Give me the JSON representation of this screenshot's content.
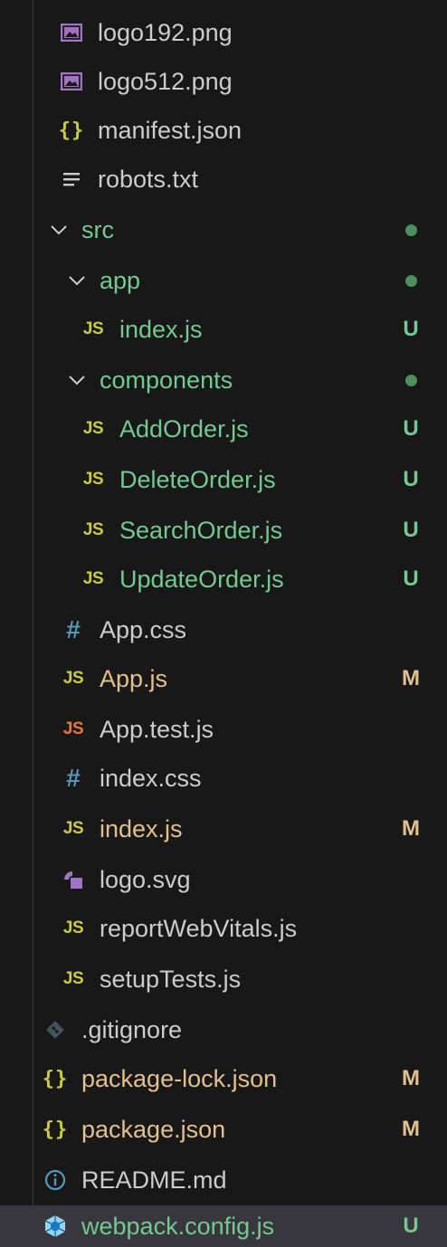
{
  "colors": {
    "background": "#181818",
    "selected_row": "#37373d",
    "untracked": "#73c991",
    "modified": "#e2c08d",
    "default_text": "#cccccc",
    "js_icon": "#cbcb41",
    "test_js_icon": "#e37933",
    "css_icon": "#519aba",
    "image_icon": "#a074c4",
    "git_dot": "#4e8f5e"
  },
  "rows": [
    {
      "label": "logo192.png",
      "icon": "image-icon",
      "icon_text": "",
      "state": "plain",
      "badge": ""
    },
    {
      "label": "logo512.png",
      "icon": "image-icon",
      "icon_text": "",
      "state": "plain",
      "badge": ""
    },
    {
      "label": "manifest.json",
      "icon": "json-braces-icon",
      "icon_text": "{}",
      "state": "plain",
      "badge": ""
    },
    {
      "label": "robots.txt",
      "icon": "text-lines-icon",
      "icon_text": "",
      "state": "plain",
      "badge": ""
    },
    {
      "label": "src",
      "icon": "chevron-down-icon",
      "icon_text": "",
      "state": "untracked",
      "badge": "dot"
    },
    {
      "label": "app",
      "icon": "chevron-down-icon",
      "icon_text": "",
      "state": "untracked",
      "badge": "dot"
    },
    {
      "label": "index.js",
      "icon": "js-icon",
      "icon_text": "JS",
      "state": "untracked",
      "badge": "U"
    },
    {
      "label": "components",
      "icon": "chevron-down-icon",
      "icon_text": "",
      "state": "untracked",
      "badge": "dot"
    },
    {
      "label": "AddOrder.js",
      "icon": "js-icon",
      "icon_text": "JS",
      "state": "untracked",
      "badge": "U"
    },
    {
      "label": "DeleteOrder.js",
      "icon": "js-icon",
      "icon_text": "JS",
      "state": "untracked",
      "badge": "U"
    },
    {
      "label": "SearchOrder.js",
      "icon": "js-icon",
      "icon_text": "JS",
      "state": "untracked",
      "badge": "U"
    },
    {
      "label": "UpdateOrder.js",
      "icon": "js-icon",
      "icon_text": "JS",
      "state": "untracked",
      "badge": "U"
    },
    {
      "label": "App.css",
      "icon": "css-hash-icon",
      "icon_text": "#",
      "state": "plain",
      "badge": ""
    },
    {
      "label": "App.js",
      "icon": "js-icon",
      "icon_text": "JS",
      "state": "modified",
      "badge": "M"
    },
    {
      "label": "App.test.js",
      "icon": "test-js-icon",
      "icon_text": "JS",
      "state": "plain",
      "badge": ""
    },
    {
      "label": "index.css",
      "icon": "css-hash-icon",
      "icon_text": "#",
      "state": "plain",
      "badge": ""
    },
    {
      "label": "index.js",
      "icon": "js-icon",
      "icon_text": "JS",
      "state": "modified",
      "badge": "M"
    },
    {
      "label": "logo.svg",
      "icon": "svg-icon",
      "icon_text": "",
      "state": "plain",
      "badge": ""
    },
    {
      "label": "reportWebVitals.js",
      "icon": "js-icon",
      "icon_text": "JS",
      "state": "plain",
      "badge": ""
    },
    {
      "label": "setupTests.js",
      "icon": "js-icon",
      "icon_text": "JS",
      "state": "plain",
      "badge": ""
    },
    {
      "label": ".gitignore",
      "icon": "git-icon",
      "icon_text": "",
      "state": "plain",
      "badge": ""
    },
    {
      "label": "package-lock.json",
      "icon": "json-braces-icon",
      "icon_text": "{}",
      "state": "modified",
      "badge": "M"
    },
    {
      "label": "package.json",
      "icon": "json-braces-icon",
      "icon_text": "{}",
      "state": "modified",
      "badge": "M"
    },
    {
      "label": "README.md",
      "icon": "info-icon",
      "icon_text": "",
      "state": "plain",
      "badge": ""
    },
    {
      "label": "webpack.config.js",
      "icon": "webpack-cube-icon",
      "icon_text": "",
      "state": "untracked",
      "badge": "U"
    }
  ]
}
